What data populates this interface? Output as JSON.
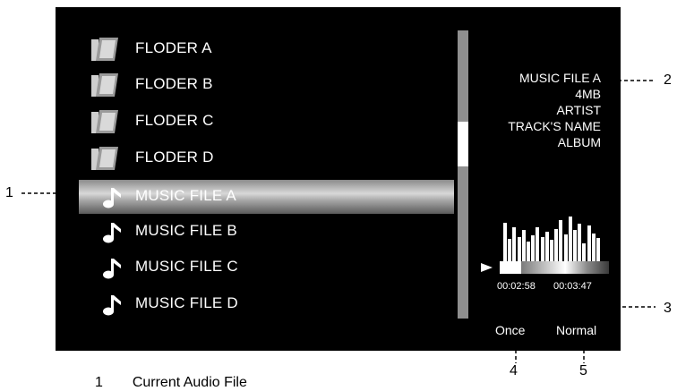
{
  "file_list": {
    "items": [
      {
        "type": "folder",
        "label": "FLODER A"
      },
      {
        "type": "folder",
        "label": "FLODER B"
      },
      {
        "type": "folder",
        "label": "FLODER C"
      },
      {
        "type": "folder",
        "label": "FLODER D"
      },
      {
        "type": "music",
        "label": "MUSIC FILE A",
        "selected": true
      },
      {
        "type": "music",
        "label": "MUSIC FILE B"
      },
      {
        "type": "music",
        "label": "MUSIC FILE C"
      },
      {
        "type": "music",
        "label": "MUSIC FILE D"
      }
    ]
  },
  "file_info": {
    "name": "MUSIC FILE A",
    "size": "4MB",
    "artist": "ARTIST",
    "track": "TRACK'S NAME",
    "album": "ALBUM"
  },
  "playback": {
    "elapsed": "00:02:58",
    "total": "00:03:47",
    "progress_fraction": 0.2,
    "repeat_mode": "Once",
    "play_mode": "Normal",
    "state_icon": "play-icon",
    "equalizer_levels": [
      0.7,
      0.42,
      0.62,
      0.46,
      0.58,
      0.38,
      0.48,
      0.62,
      0.45,
      0.55,
      0.4,
      0.6,
      0.75,
      0.5,
      0.82,
      0.58,
      0.68,
      0.35,
      0.65,
      0.52,
      0.44
    ]
  },
  "callouts": [
    "1",
    "2",
    "3",
    "4",
    "5"
  ],
  "legend": {
    "number": "1",
    "text": "Current Audio File"
  }
}
